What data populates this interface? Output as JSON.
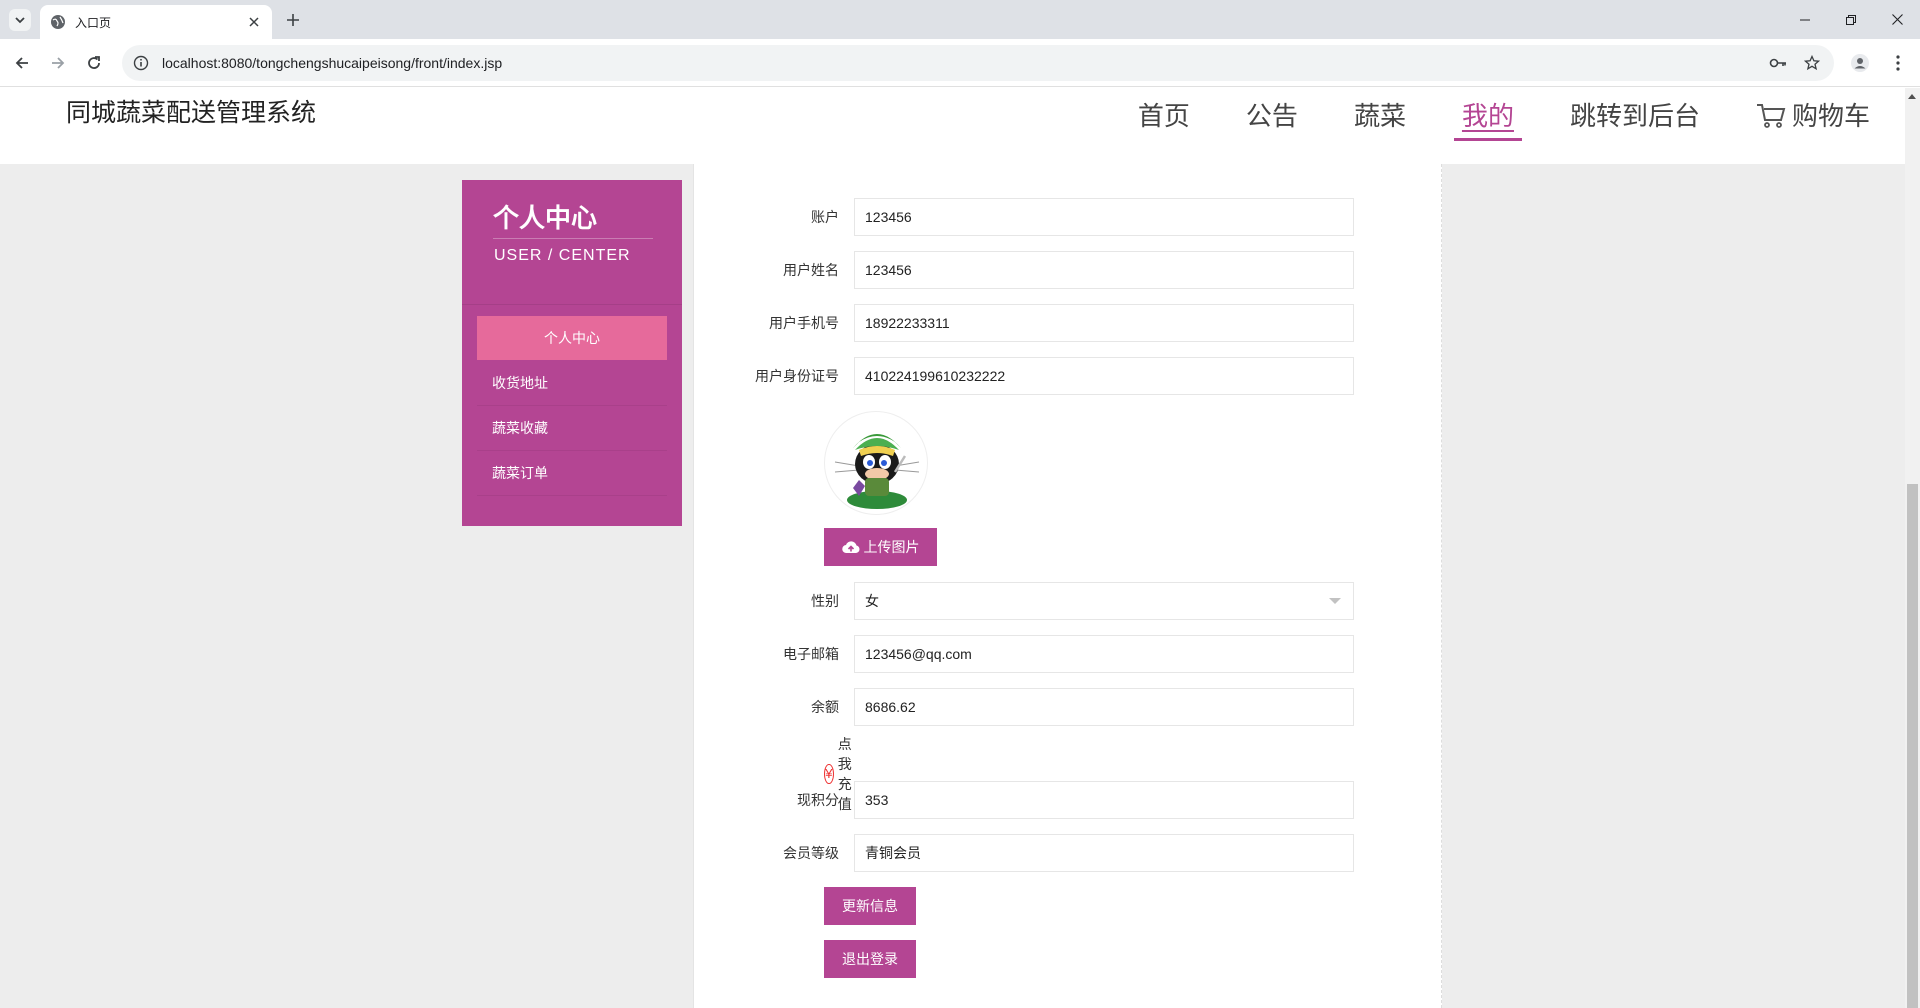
{
  "browser": {
    "tab_title": "入口页",
    "url": "localhost:8080/tongchengshucaipeisong/front/index.jsp"
  },
  "site": {
    "title": "同城蔬菜配送管理系统",
    "nav": [
      {
        "label": "首页"
      },
      {
        "label": "公告"
      },
      {
        "label": "蔬菜"
      },
      {
        "label": "我的",
        "active": true
      },
      {
        "label": "跳转到后台"
      },
      {
        "label": "购物车"
      }
    ]
  },
  "sidebar": {
    "title": "个人中心",
    "subtitle": "USER / CENTER",
    "items": [
      {
        "label": "个人中心",
        "active": true
      },
      {
        "label": "收货地址"
      },
      {
        "label": "蔬菜收藏"
      },
      {
        "label": "蔬菜订单"
      }
    ]
  },
  "form": {
    "account": {
      "label": "账户",
      "value": "123456"
    },
    "name": {
      "label": "用户姓名",
      "value": "123456"
    },
    "phone": {
      "label": "用户手机号",
      "value": "18922233311"
    },
    "id_card": {
      "label": "用户身份证号",
      "value": "410224199610232222"
    },
    "upload_label": "上传图片",
    "gender": {
      "label": "性别",
      "value": "女"
    },
    "email": {
      "label": "电子邮箱",
      "value": "123456@qq.com"
    },
    "balance": {
      "label": "余额",
      "value": "8686.62"
    },
    "recharge_label": "点我充值",
    "points": {
      "label": "现积分",
      "value": "353"
    },
    "level": {
      "label": "会员等级",
      "value": "青铜会员"
    },
    "update_label": "更新信息",
    "logout_label": "退出登录"
  },
  "colors": {
    "accent": "#b44593",
    "sidebar_active": "#e66a9b"
  }
}
